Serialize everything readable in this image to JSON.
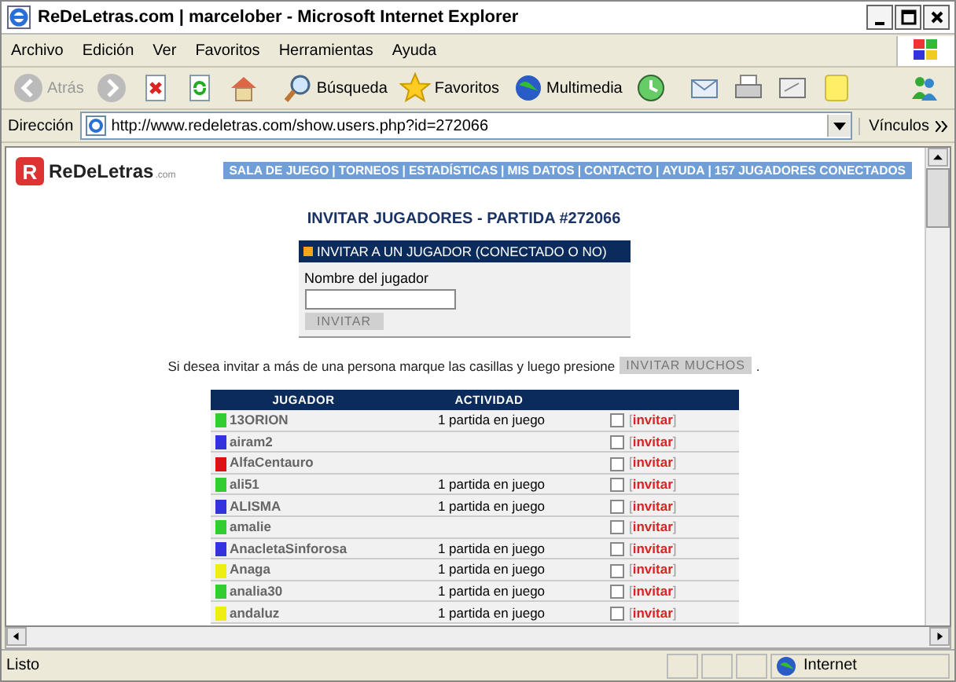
{
  "window": {
    "title": "ReDeLetras.com | marcelober - Microsoft Internet Explorer"
  },
  "menu": [
    "Archivo",
    "Edición",
    "Ver",
    "Favoritos",
    "Herramientas",
    "Ayuda"
  ],
  "toolbar": [
    {
      "kind": "back",
      "label": "Atrás",
      "disabled": true
    },
    {
      "kind": "forward",
      "disabled": true
    },
    {
      "kind": "stop"
    },
    {
      "kind": "refresh"
    },
    {
      "kind": "home"
    },
    {
      "kind": "search",
      "label": "Búsqueda"
    },
    {
      "kind": "favorites",
      "label": "Favoritos"
    },
    {
      "kind": "media",
      "label": "Multimedia"
    },
    {
      "kind": "history"
    },
    {
      "kind": "mail"
    },
    {
      "kind": "print"
    },
    {
      "kind": "edit"
    },
    {
      "kind": "note"
    },
    {
      "kind": "messenger"
    }
  ],
  "address": {
    "label": "Dirección",
    "url": "http://www.redeletras.com/show.users.php?id=272066",
    "links": "Vínculos"
  },
  "site": {
    "logo_mark": "R",
    "logo": "ReDeLetras",
    "logo_sub": ".com",
    "nav": [
      "SALA DE JUEGO",
      "TORNEOS",
      "ESTADÍSTICAS",
      "MIS DATOS",
      "CONTACTO",
      "AYUDA",
      "157 JUGADORES CONECTADOS"
    ],
    "nav_separator": "|",
    "title": "INVITAR JUGADORES - PARTIDA #272066",
    "panel": {
      "title": "INVITAR A UN JUGADOR (CONECTADO O NO)",
      "field_label": "Nombre del jugador",
      "button": "INVITAR"
    },
    "hint": "Si desea invitar a más de una persona marque las casillas y luego presione",
    "hint_button": "INVITAR MUCHOS",
    "hint_end": ".",
    "table": {
      "columns": [
        "JUGADOR",
        "ACTIVIDAD"
      ],
      "brackets": [
        "[",
        "]"
      ],
      "rows": [
        {
          "name": "13ORION",
          "color": "#33cc33",
          "activity": "1 partida en juego",
          "checked": false,
          "action": "invitar"
        },
        {
          "name": "airam2",
          "color": "#3333dd",
          "checked": false,
          "action": "invitar"
        },
        {
          "name": "AlfaCentauro",
          "color": "#dd1111",
          "checked": false,
          "action": "invitar"
        },
        {
          "name": "ali51",
          "color": "#33cc33",
          "activity": "1 partida en juego",
          "checked": false,
          "action": "invitar"
        },
        {
          "name": "ALISMA",
          "color": "#3333dd",
          "activity": "1 partida en juego",
          "checked": false,
          "action": "invitar"
        },
        {
          "name": "amalie",
          "color": "#33cc33",
          "checked": false,
          "action": "invitar"
        },
        {
          "name": "AnacletaSinforosa",
          "color": "#3333dd",
          "activity": "1 partida en juego",
          "checked": false,
          "action": "invitar"
        },
        {
          "name": "Anaga",
          "color": "#eeee11",
          "activity": "1 partida en juego",
          "checked": false,
          "action": "invitar"
        },
        {
          "name": "analia30",
          "color": "#33cc33",
          "activity": "1 partida en juego",
          "checked": false,
          "action": "invitar"
        },
        {
          "name": "andaluz",
          "color": "#eeee11",
          "activity": "1 partida en juego",
          "checked": false,
          "action": "invitar"
        }
      ]
    }
  },
  "status": {
    "text": "Listo",
    "zone": "Internet"
  }
}
